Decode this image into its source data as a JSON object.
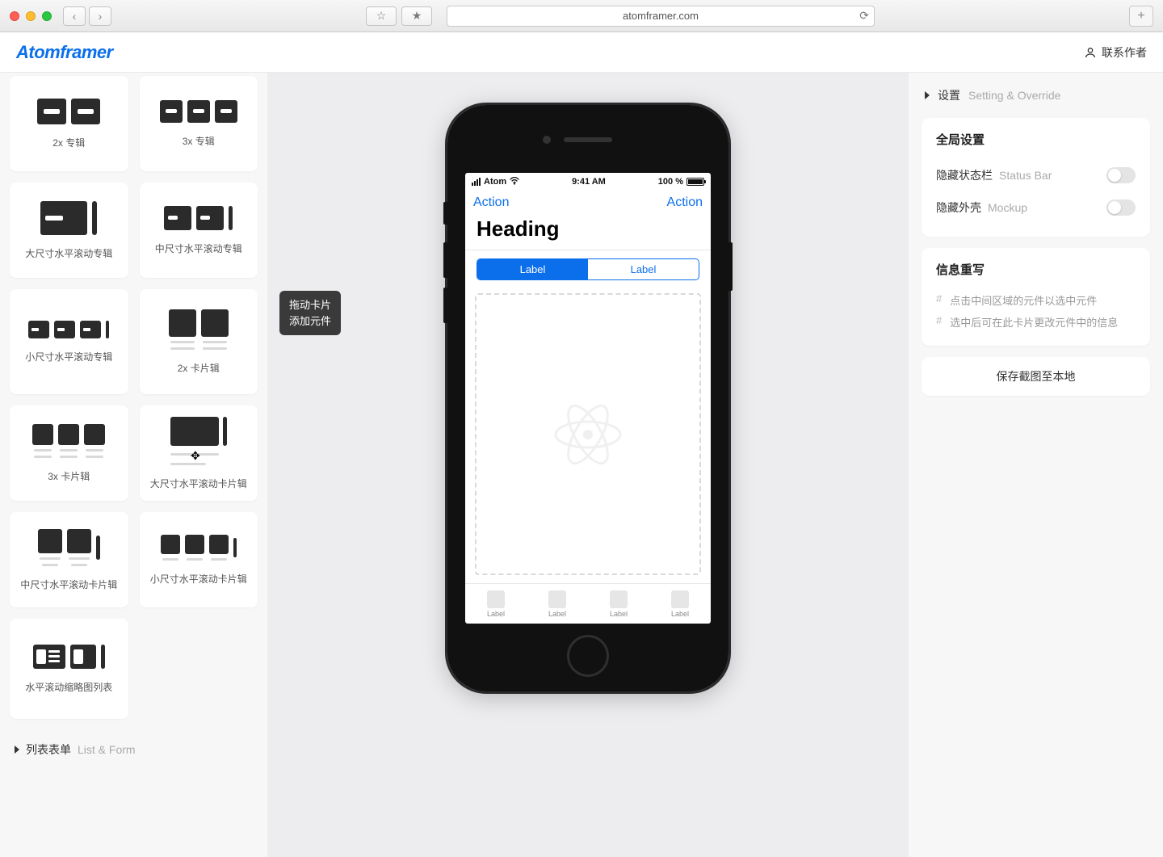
{
  "browser": {
    "url": "atomframer.com"
  },
  "app": {
    "name": "Atomframer",
    "contact": "联系作者"
  },
  "tooltip": {
    "line1": "拖动卡片",
    "line2": "添加元件"
  },
  "sidebar": {
    "components": [
      {
        "id": "2x-album",
        "label": "2x 专辑"
      },
      {
        "id": "3x-album",
        "label": "3x 专辑"
      },
      {
        "id": "large-hscroll-album",
        "label": "大尺寸水平滚动专辑"
      },
      {
        "id": "medium-hscroll-album",
        "label": "中尺寸水平滚动专辑"
      },
      {
        "id": "small-hscroll-album",
        "label": "小尺寸水平滚动专辑"
      },
      {
        "id": "2x-cards",
        "label": "2x 卡片辑"
      },
      {
        "id": "3x-cards",
        "label": "3x 卡片辑"
      },
      {
        "id": "large-hscroll-cards",
        "label": "大尺寸水平滚动卡片辑"
      },
      {
        "id": "medium-hscroll-cards",
        "label": "中尺寸水平滚动卡片辑"
      },
      {
        "id": "small-hscroll-cards",
        "label": "小尺寸水平滚动卡片辑"
      },
      {
        "id": "hscroll-thumb-list",
        "label": "水平滚动缩略图列表"
      }
    ],
    "section": {
      "cn": "列表表单",
      "en": "List & Form"
    }
  },
  "phone": {
    "status": {
      "carrier": "Atom",
      "time": "9:41 AM",
      "battery": "100 %"
    },
    "nav_left": "Action",
    "nav_right": "Action",
    "heading": "Heading",
    "seg_on": "Label",
    "seg_off": "Label",
    "tabs": [
      "Label",
      "Label",
      "Label",
      "Label"
    ]
  },
  "right": {
    "header": {
      "cn": "设置",
      "en": "Setting & Override"
    },
    "global_title": "全局设置",
    "row1": {
      "cn": "隐藏状态栏",
      "en": "Status Bar"
    },
    "row2": {
      "cn": "隐藏外壳",
      "en": "Mockup"
    },
    "info_title": "信息重写",
    "hint1": "点击中间区域的元件以选中元件",
    "hint2": "选中后可在此卡片更改元件中的信息",
    "save": "保存截图至本地"
  }
}
